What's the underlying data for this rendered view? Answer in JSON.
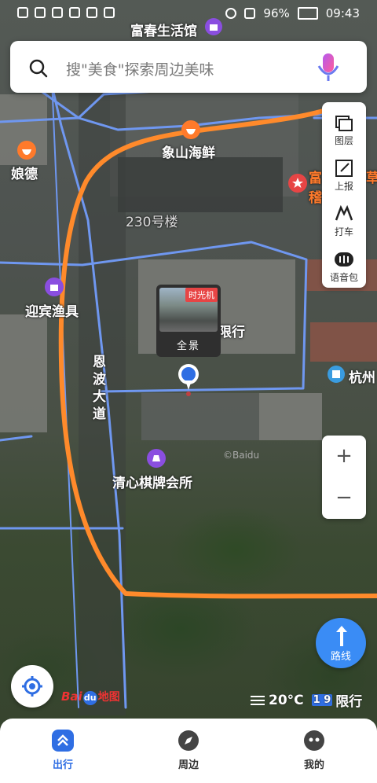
{
  "status_bar": {
    "battery": "96%",
    "time": "09:43"
  },
  "search": {
    "placeholder": "搜\"美食\"探索周边美味"
  },
  "map_labels": {
    "top_poi": "富春生活馆",
    "xiangshan": "象山海鲜",
    "niangde": "娘德",
    "fuji": "富稽",
    "cao": "草",
    "building_230": "230号楼",
    "yingbin": "迎宾渔具",
    "xingxing": "限行",
    "enbo": "恩波大道",
    "hangzhou": "杭州",
    "qingxin": "清心棋牌会所",
    "watermark": "©Baidu"
  },
  "pano": {
    "tag": "时光机",
    "label": "全景"
  },
  "toolbar": {
    "items": [
      {
        "label": "图层",
        "icon": "layers-icon"
      },
      {
        "label": "上报",
        "icon": "report-icon"
      },
      {
        "label": "打车",
        "icon": "taxi-icon"
      },
      {
        "label": "语音包",
        "icon": "voice-pack-icon"
      }
    ]
  },
  "zoom": {
    "in": "+",
    "out": "−"
  },
  "route_button": {
    "label": "路线"
  },
  "logo": {
    "bai": "Bai",
    "du": "du",
    "ditu": "地图"
  },
  "weather": {
    "temp": "20°C",
    "plate": "1 9",
    "restriction": "限行"
  },
  "tabs": [
    {
      "label": "出行",
      "active": true,
      "color": "#2f6ee3"
    },
    {
      "label": "周边",
      "active": false,
      "color": "#444444"
    },
    {
      "label": "我的",
      "active": false,
      "color": "#444444"
    }
  ],
  "colors": {
    "accent": "#2f6ee3",
    "route_line": "#ff8a2b",
    "road_line": "#6f97f0",
    "poi_pin": "#e74545"
  }
}
